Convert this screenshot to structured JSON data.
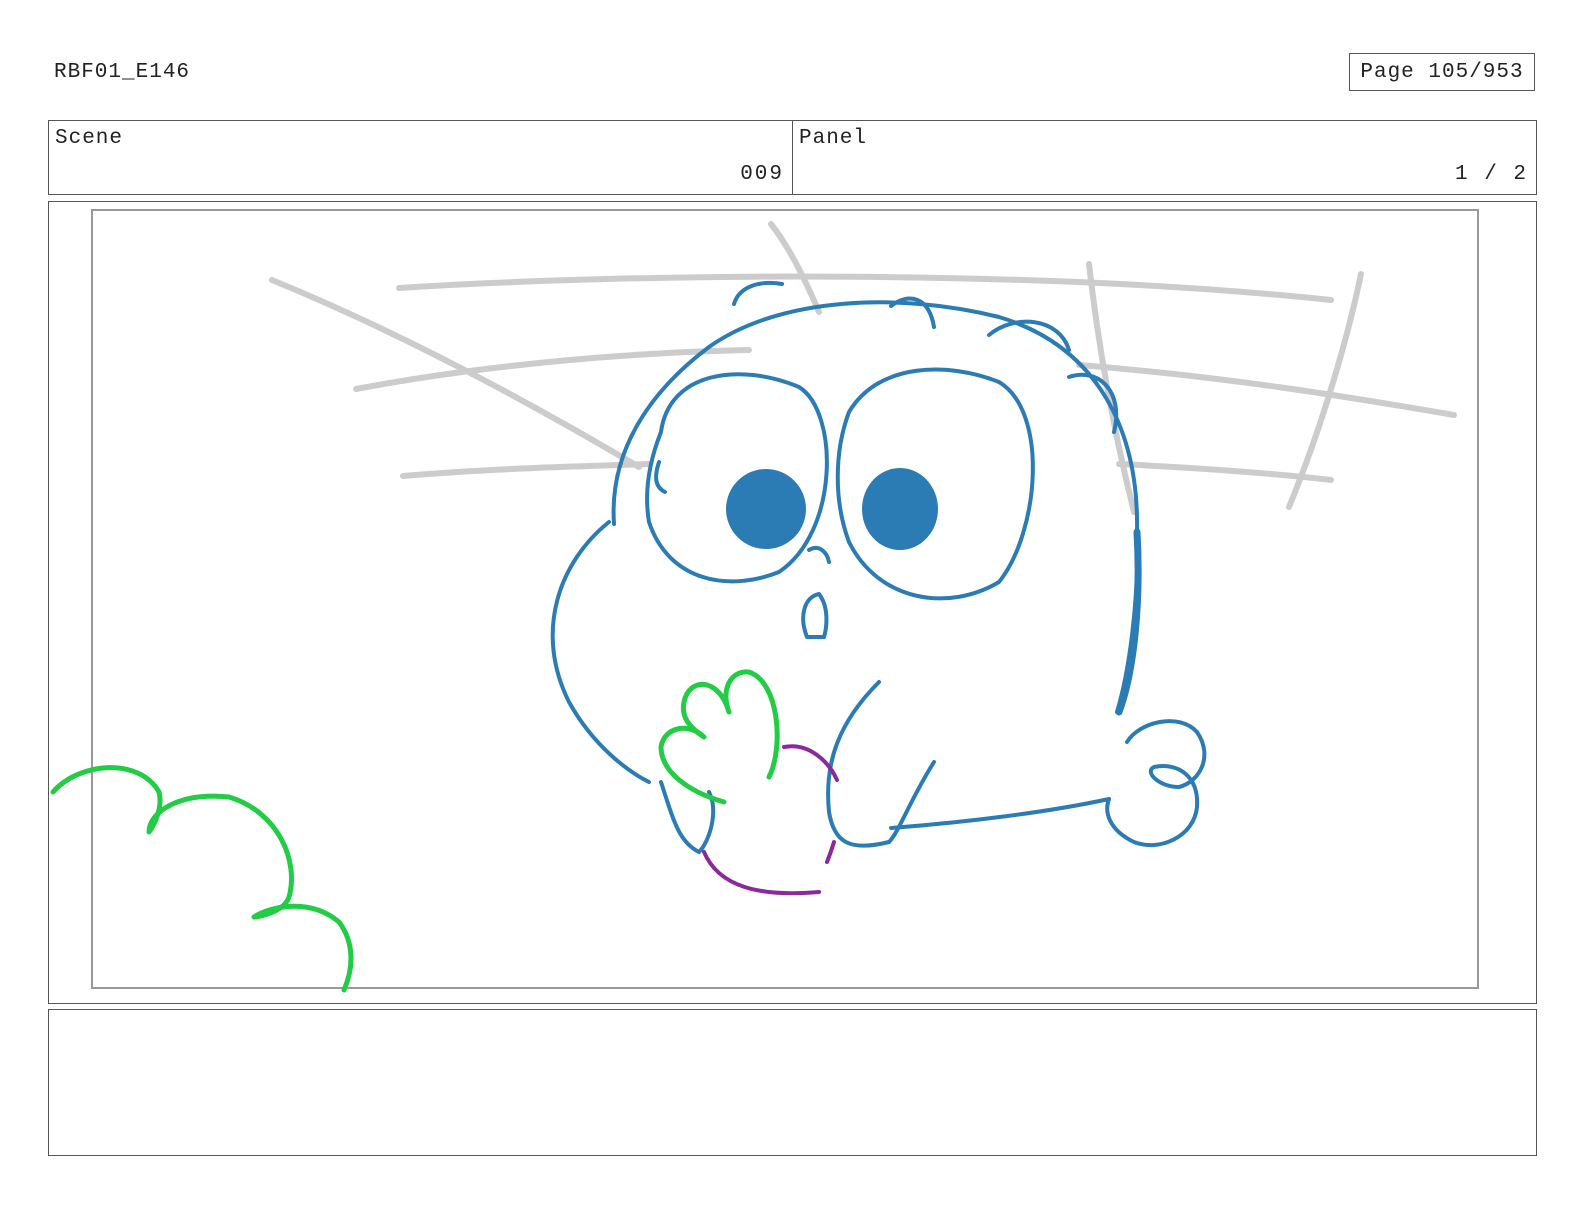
{
  "header": {
    "doc_id": "RBF01_E146",
    "page_label": "Page 105/953"
  },
  "info": {
    "scene_label": "Scene",
    "scene_value": "009",
    "panel_label": "Panel",
    "panel_value": "1 / 2"
  },
  "artwork": {
    "colors": {
      "character_line": "#2b7bb5",
      "bush_line": "#22cc44",
      "prop_line": "#8a2a9a",
      "background_sketch": "#cccccc",
      "safe_frame": "#999999"
    }
  },
  "notes": {
    "text": ""
  }
}
